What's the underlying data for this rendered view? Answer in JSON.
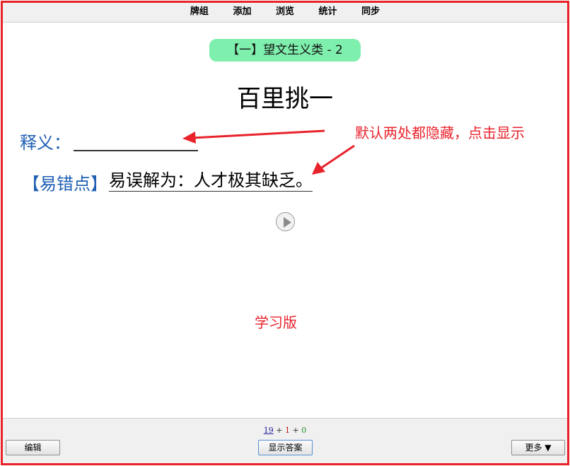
{
  "topbar": {
    "items": [
      "牌组",
      "添加",
      "浏览",
      "统计",
      "同步"
    ]
  },
  "card": {
    "deck_tag": "【一】望文生义类 - 2",
    "word": "百里挑一",
    "meaning_label": "释义：",
    "error_label": "【易错点】",
    "error_text": "易误解为：人才极其缺乏。"
  },
  "annotations": {
    "hidden_note": "默认两处都隐藏，点击显示",
    "version_note": "学习版"
  },
  "bottombar": {
    "count_new": "19",
    "count_learn": "1",
    "count_review": "0",
    "plus": "+",
    "edit_label": "编辑",
    "show_answer_label": "显示答案",
    "more_label": "更多 ▼"
  },
  "colors": {
    "frame": "#e8232c",
    "label_blue": "#1e5fb4",
    "pill_green": "#7fefad"
  },
  "icons": {
    "play": "play-icon",
    "arrow": "red-arrow"
  }
}
